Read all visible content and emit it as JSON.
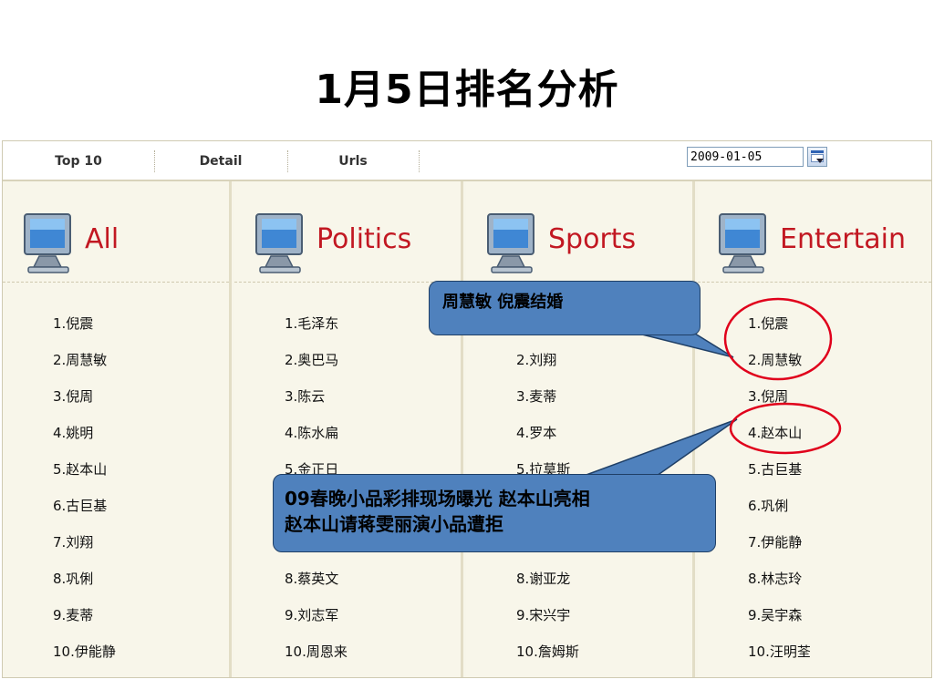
{
  "slide": {
    "title": "1月5日排名分析"
  },
  "tabs": [
    {
      "label": "Top 10"
    },
    {
      "label": "Detail"
    },
    {
      "label": "Urls"
    }
  ],
  "date_picker": {
    "value": "2009-01-05",
    "icon": "calendar-icon"
  },
  "columns": [
    {
      "label": "All",
      "icon": "monitor-icon",
      "items": [
        "1.倪震",
        "2.周慧敏",
        "3.倪周",
        "4.姚明",
        "5.赵本山",
        "6.古巨基",
        "7.刘翔",
        "8.巩俐",
        "9.麦蒂",
        "10.伊能静"
      ]
    },
    {
      "label": "Politics",
      "icon": "monitor-icon",
      "items": [
        "1.毛泽东",
        "2.奥巴马",
        "3.陈云",
        "4.陈水扁",
        "5.金正日",
        "",
        "",
        "8.蔡英文",
        "9.刘志军",
        "10.周恩来"
      ]
    },
    {
      "label": "Sports",
      "icon": "monitor-icon",
      "items": [
        "",
        "2.刘翔",
        "3.麦蒂",
        "4.罗本",
        "5.拉莫斯",
        "",
        "",
        "8.谢亚龙",
        "9.宋兴宇",
        "10.詹姆斯"
      ]
    },
    {
      "label": "Entertain",
      "icon": "monitor-icon",
      "items": [
        "1.倪震",
        "2.周慧敏",
        "3.倪周",
        "4.赵本山",
        "5.古巨基",
        "6.巩俐",
        "7.伊能静",
        "8.林志玲",
        "9.吴宇森",
        "10.汪明荃"
      ]
    }
  ],
  "callouts": [
    {
      "text": "周慧敏 倪震结婚"
    },
    {
      "line1": "09春晚小品彩排现场曝光 赵本山亮相",
      "line2": "赵本山请蒋雯丽演小品遭拒"
    }
  ],
  "colors": {
    "title": "#000000",
    "column_label": "#c21822",
    "callout_fill": "#4f81bd",
    "highlight_circle": "#e0001b"
  }
}
